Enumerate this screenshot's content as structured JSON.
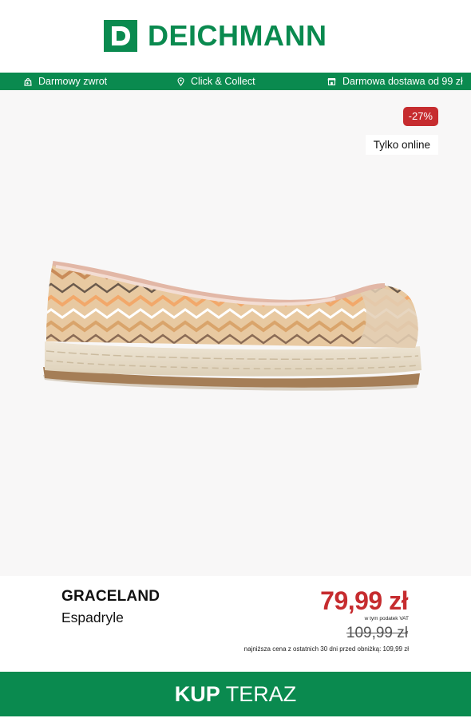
{
  "brand_logo": {
    "letter": "D",
    "word": "DEICHMANN",
    "color": "#0a8a4f"
  },
  "usp_bar": {
    "items": [
      {
        "icon": "return-bag-icon",
        "label": "Darmowy zwrot"
      },
      {
        "icon": "location-pin-icon",
        "label": "Click & Collect"
      },
      {
        "icon": "store-icon",
        "label": "Darmowa dostawa od 99 zł"
      }
    ]
  },
  "product": {
    "discount_badge": "-27%",
    "online_badge": "Tylko online",
    "image_icon": "espadrille-shoe-image",
    "brand": "GRACELAND",
    "type": "Espadryle",
    "price": "79,99 zł",
    "vat_note": "w tym podatek VAT",
    "old_price": "109,99 zł",
    "lowest_price_note": "najniższa cena z ostatnich 30 dni przed obniżką: 109,99 zł"
  },
  "cta": {
    "bold": "KUP",
    "rest": "TERAZ"
  },
  "colors": {
    "accent": "#0a8a4f",
    "sale": "#c62c2f",
    "product_bg": "#f8f7f7"
  }
}
